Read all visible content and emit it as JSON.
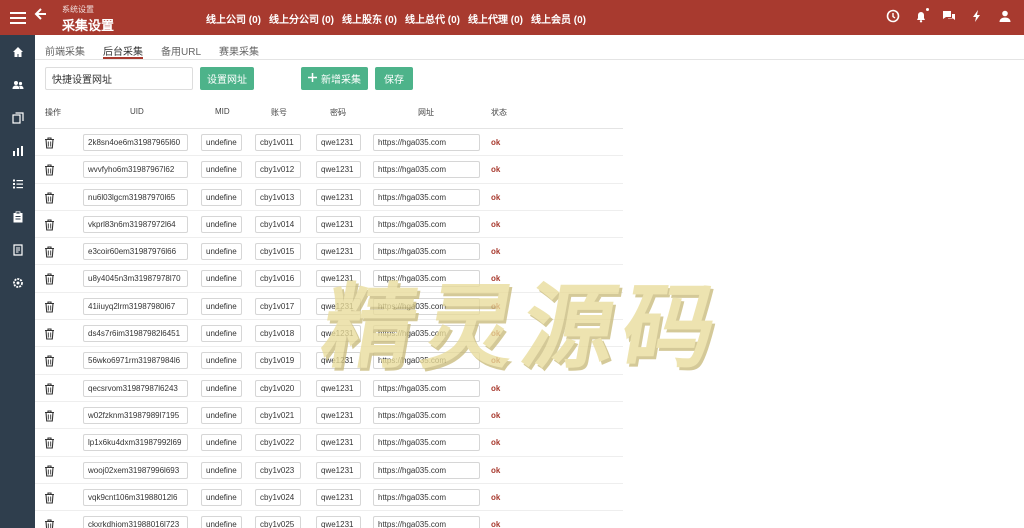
{
  "header": {
    "breadcrumb": "系统设置",
    "title": "采集设置",
    "stats": [
      "线上公司 (0)",
      "线上分公司 (0)",
      "线上股东 (0)",
      "线上总代 (0)",
      "线上代理 (0)",
      "线上会员 (0)"
    ]
  },
  "tabs": [
    {
      "label": "前端采集"
    },
    {
      "label": "后台采集"
    },
    {
      "label": "备用URL"
    },
    {
      "label": "赛果采集"
    }
  ],
  "toolbar": {
    "quick_url_value": "快捷设置网址",
    "set_url_label": "设置网址",
    "add_label": "新增采集",
    "save_label": "保存"
  },
  "table": {
    "headers": [
      "操作",
      "UID",
      "MID",
      "账号",
      "密码",
      "网址",
      "状态"
    ],
    "rows": [
      {
        "uid": "2k8sn4oe6m31987965l60",
        "mid": "undefined",
        "account": "cby1v011",
        "password": "qwe1231",
        "url": "https://hga035.com",
        "status": "ok"
      },
      {
        "uid": "wvvfyho6m31987967l62",
        "mid": "undefined",
        "account": "cby1v012",
        "password": "qwe1231",
        "url": "https://hga035.com",
        "status": "ok"
      },
      {
        "uid": "nu6l03lgcm31987970l65",
        "mid": "undefined",
        "account": "cby1v013",
        "password": "qwe1231",
        "url": "https://hga035.com",
        "status": "ok"
      },
      {
        "uid": "vkprl83n6m31987972l64",
        "mid": "undefined",
        "account": "cby1v014",
        "password": "qwe1231",
        "url": "https://hga035.com",
        "status": "ok"
      },
      {
        "uid": "e3coir60em31987976l66",
        "mid": "undefined",
        "account": "cby1v015",
        "password": "qwe1231",
        "url": "https://hga035.com",
        "status": "ok"
      },
      {
        "uid": "u8y4045n3m31987978l70",
        "mid": "undefined",
        "account": "cby1v016",
        "password": "qwe1231",
        "url": "https://hga035.com",
        "status": "ok"
      },
      {
        "uid": "41iiuyq2lrm31987980l67",
        "mid": "undefined",
        "account": "cby1v017",
        "password": "qwe1231",
        "url": "https://hga035.com",
        "status": "ok"
      },
      {
        "uid": "ds4s7r6im31987982l6451",
        "mid": "undefined",
        "account": "cby1v018",
        "password": "qwe1231",
        "url": "https://hga035.com",
        "status": "ok"
      },
      {
        "uid": "56wko6971rm31987984l6",
        "mid": "undefined",
        "account": "cby1v019",
        "password": "qwe1231",
        "url": "https://hga035.com",
        "status": "ok"
      },
      {
        "uid": "qecsrvom31987987l6243",
        "mid": "undefined",
        "account": "cby1v020",
        "password": "qwe1231",
        "url": "https://hga035.com",
        "status": "ok"
      },
      {
        "uid": "w02fzknm31987989l7195",
        "mid": "undefined",
        "account": "cby1v021",
        "password": "qwe1231",
        "url": "https://hga035.com",
        "status": "ok"
      },
      {
        "uid": "lp1x6ku4dxm31987992l69",
        "mid": "undefined",
        "account": "cby1v022",
        "password": "qwe1231",
        "url": "https://hga035.com",
        "status": "ok"
      },
      {
        "uid": "wooj02xem31987996l693",
        "mid": "undefined",
        "account": "cby1v023",
        "password": "qwe1231",
        "url": "https://hga035.com",
        "status": "ok"
      },
      {
        "uid": "vqk9cnt106m31988012l6",
        "mid": "undefined",
        "account": "cby1v024",
        "password": "qwe1231",
        "url": "https://hga035.com",
        "status": "ok"
      },
      {
        "uid": "ckxrkdhiom31988016l723",
        "mid": "undefined",
        "account": "cby1v025",
        "password": "qwe1231",
        "url": "https://hga035.com",
        "status": "ok"
      }
    ]
  },
  "watermark": "精灵源码",
  "colors": {
    "brand": "#a83a2f",
    "accent": "#4db38a",
    "sidebar": "#2f3e4d"
  },
  "icons": {
    "header": [
      "menu-icon",
      "back-arrow-icon",
      "clock-icon",
      "bell-icon",
      "chat-icon",
      "lightning-icon",
      "user-icon"
    ],
    "sidebar": [
      "home-icon",
      "users-icon",
      "copy-icon",
      "chart-icon",
      "list-icon",
      "clipboard-icon",
      "document-icon",
      "settings-icon"
    ],
    "row": "trash-icon"
  }
}
